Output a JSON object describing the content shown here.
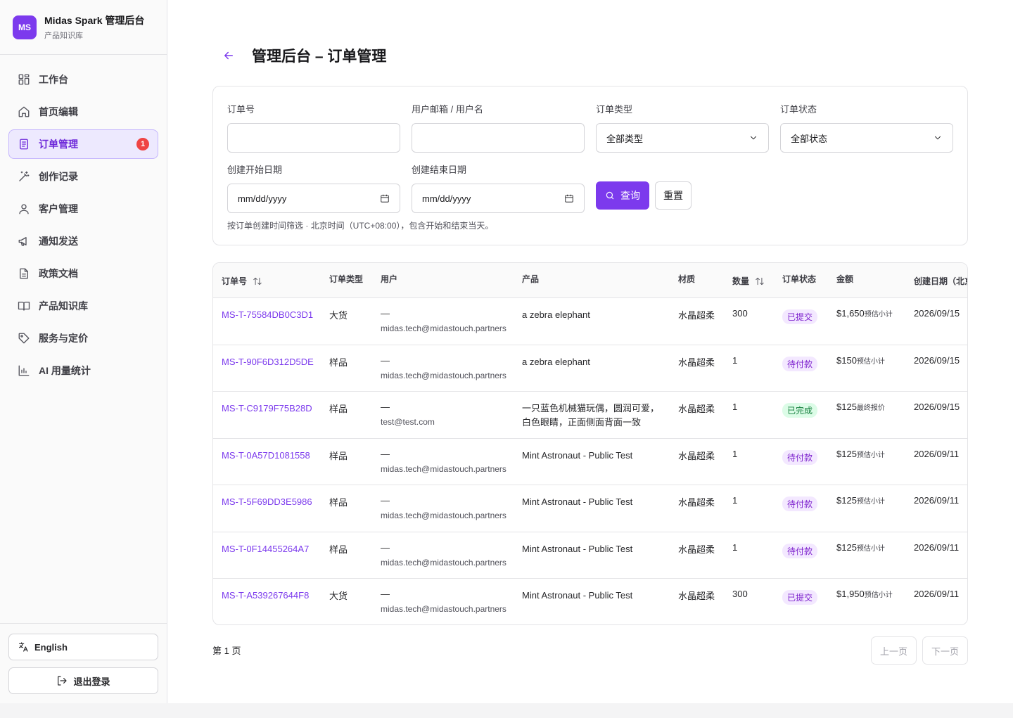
{
  "brand": {
    "logo": "MS",
    "title": "Midas Spark 管理后台",
    "subtitle": "产品知识库"
  },
  "nav": [
    {
      "label": "工作台",
      "icon": "grid-icon"
    },
    {
      "label": "首页编辑",
      "icon": "home-icon"
    },
    {
      "label": "订单管理",
      "icon": "document-icon",
      "active": true,
      "badge": "1"
    },
    {
      "label": "创作记录",
      "icon": "magic-wand-icon"
    },
    {
      "label": "客户管理",
      "icon": "user-icon"
    },
    {
      "label": "通知发送",
      "icon": "megaphone-icon"
    },
    {
      "label": "政策文档",
      "icon": "file-text-icon"
    },
    {
      "label": "产品知识库",
      "icon": "book-icon"
    },
    {
      "label": "服务与定价",
      "icon": "tag-icon"
    },
    {
      "label": "AI 用量统计",
      "icon": "bar-chart-icon"
    }
  ],
  "footer": {
    "language": "English",
    "logout": "退出登录"
  },
  "page": {
    "title": "管理后台 – 订单管理"
  },
  "filters": {
    "order_no_label": "订单号",
    "user_label": "用户邮箱 / 用户名",
    "type_label": "订单类型",
    "type_value": "全部类型",
    "status_label": "订单状态",
    "status_value": "全部状态",
    "start_label": "创建开始日期",
    "start_placeholder": "mm/dd/yyyy",
    "end_label": "创建结束日期",
    "end_placeholder": "mm/dd/yyyy",
    "query": "查询",
    "reset": "重置",
    "hint": "按订单创建时间筛选 · 北京时间（UTC+08:00），包含开始和结束当天。"
  },
  "table": {
    "headers": [
      "订单号",
      "订单类型",
      "用户",
      "产品",
      "材质",
      "数量",
      "订单状态",
      "金额",
      "创建日期（北京"
    ],
    "rows": [
      {
        "order": "MS-T-75584DB0C3D1",
        "type": "大货",
        "user": "—",
        "email": "midas.tech@midastouch.partners",
        "product": "a zebra elephant",
        "material": "水晶超柔",
        "qty": "300",
        "status": "已提交",
        "amount": "$1,650",
        "amount_note": "预估小计",
        "date": "2026/09/15"
      },
      {
        "order": "MS-T-90F6D312D5DE",
        "type": "样品",
        "user": "—",
        "email": "midas.tech@midastouch.partners",
        "product": "a zebra elephant",
        "material": "水晶超柔",
        "qty": "1",
        "status": "待付款",
        "amount": "$150",
        "amount_note": "预估小计",
        "date": "2026/09/15"
      },
      {
        "order": "MS-T-C9179F75B28D",
        "type": "样品",
        "user": "—",
        "email": "test@test.com",
        "product": "一只蓝色机械猫玩偶，圆润可爱，白色眼睛，正面侧面背面一致",
        "material": "水晶超柔",
        "qty": "1",
        "status": "已完成",
        "amount": "$125",
        "amount_note": "最终报价",
        "date": "2026/09/15"
      },
      {
        "order": "MS-T-0A57D1081558",
        "type": "样品",
        "user": "—",
        "email": "midas.tech@midastouch.partners",
        "product": "Mint Astronaut - Public Test",
        "material": "水晶超柔",
        "qty": "1",
        "status": "待付款",
        "amount": "$125",
        "amount_note": "预估小计",
        "date": "2026/09/11"
      },
      {
        "order": "MS-T-5F69DD3E5986",
        "type": "样品",
        "user": "—",
        "email": "midas.tech@midastouch.partners",
        "product": "Mint Astronaut - Public Test",
        "material": "水晶超柔",
        "qty": "1",
        "status": "待付款",
        "amount": "$125",
        "amount_note": "预估小计",
        "date": "2026/09/11"
      },
      {
        "order": "MS-T-0F14455264A7",
        "type": "样品",
        "user": "—",
        "email": "midas.tech@midastouch.partners",
        "product": "Mint Astronaut - Public Test",
        "material": "水晶超柔",
        "qty": "1",
        "status": "待付款",
        "amount": "$125",
        "amount_note": "预估小计",
        "date": "2026/09/11"
      },
      {
        "order": "MS-T-A539267644F8",
        "type": "大货",
        "user": "—",
        "email": "midas.tech@midastouch.partners",
        "product": "Mint Astronaut - Public Test",
        "material": "水晶超柔",
        "qty": "300",
        "status": "已提交",
        "amount": "$1,950",
        "amount_note": "预估小计",
        "date": "2026/09/11"
      }
    ]
  },
  "status_colors": {
    "已提交": {
      "bg": "#f3e8ff",
      "fg": "#7e22ce"
    },
    "待付款": {
      "bg": "#f3e8ff",
      "fg": "#7e22ce"
    },
    "已完成": {
      "bg": "#dcfce7",
      "fg": "#15803d"
    }
  },
  "pagination": {
    "label": "第 1 页",
    "prev": "上一页",
    "next": "下一页"
  },
  "colors": {
    "accent": "#7c3aed",
    "badge": "#ef4444"
  }
}
